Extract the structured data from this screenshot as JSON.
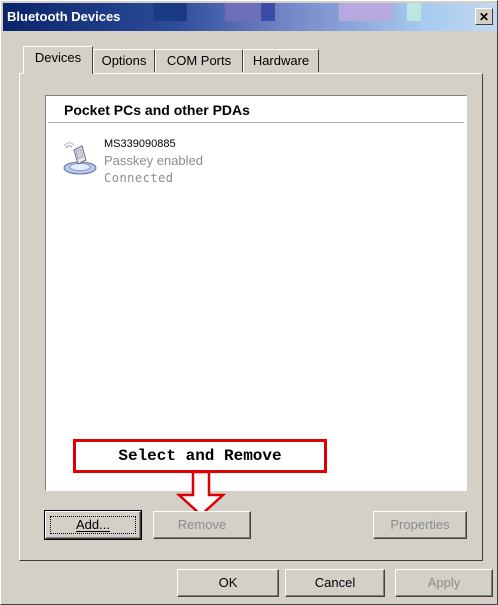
{
  "window": {
    "title": "Bluetooth Devices",
    "close_glyph": "✕"
  },
  "tabs": [
    {
      "label": "Devices",
      "active": true
    },
    {
      "label": "Options",
      "active": false
    },
    {
      "label": "COM Ports",
      "active": false
    },
    {
      "label": "Hardware",
      "active": false
    }
  ],
  "device_list": {
    "group_header": "Pocket PCs and other PDAs",
    "devices": [
      {
        "name": "MS339090885",
        "status": "Passkey enabled",
        "connection": "Connected",
        "icon": "pda-device-icon"
      }
    ]
  },
  "annotation": {
    "callout_text": "Select and Remove",
    "callout_color": "#e00000"
  },
  "panel_buttons": {
    "add": "Add...",
    "remove": "Remove",
    "properties": "Properties"
  },
  "dialog_buttons": {
    "ok": "OK",
    "cancel": "Cancel",
    "apply": "Apply"
  }
}
